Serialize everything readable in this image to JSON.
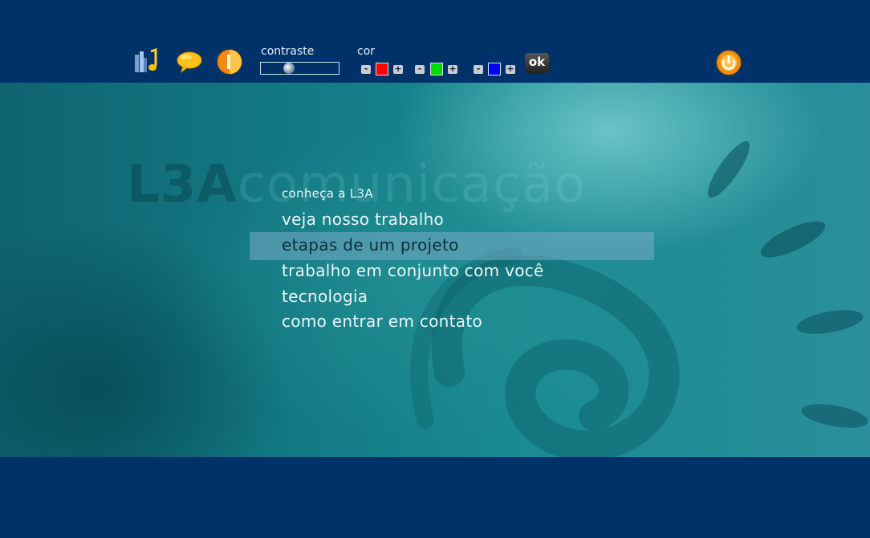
{
  "toolbar": {
    "contrast_label": "contraste",
    "color_label": "cor",
    "ok_label": "ok",
    "minus": "-",
    "plus": "+",
    "colors": {
      "red": "#ff0000",
      "green": "#00dd00",
      "blue": "#0000ff"
    },
    "icons": [
      "library-music-icon",
      "speech-bubble-icon",
      "half-contrast-icon",
      "power-icon"
    ]
  },
  "background_title": {
    "part1": "L3A",
    "part2": "comunicação"
  },
  "menu": {
    "items": [
      {
        "label": "conheça a L3A"
      },
      {
        "label": "veja nosso trabalho"
      },
      {
        "label": "etapas de um projeto"
      },
      {
        "label": "trabalho em conjunto com você"
      },
      {
        "label": "tecnologia"
      },
      {
        "label": "como entrar em contato"
      }
    ],
    "selected_index": 2
  },
  "colors": {
    "bar": "#00326a",
    "highlight": "#78aac8"
  }
}
